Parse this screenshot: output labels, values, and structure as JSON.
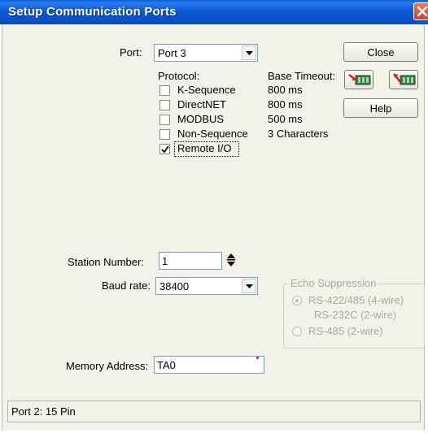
{
  "window": {
    "title": "Setup Communication Ports",
    "colors": {
      "titlebar": "#0a5fd8",
      "close_button": "#d55a3c",
      "background": "#f2f1ea"
    }
  },
  "port": {
    "label": "Port:",
    "selected": "Port 3"
  },
  "buttons": {
    "close": "Close",
    "help": "Help",
    "upload_icon": "plc-to-pc-icon",
    "download_icon": "pc-to-plc-icon"
  },
  "protocol": {
    "header": "Protocol:",
    "timeout_header": "Base Timeout:",
    "items": [
      {
        "label": "K-Sequence",
        "timeout": "800 ms",
        "checked": false
      },
      {
        "label": "DirectNET",
        "timeout": "800 ms",
        "checked": false
      },
      {
        "label": "MODBUS",
        "timeout": "500 ms",
        "checked": false
      },
      {
        "label": "Non-Sequence",
        "timeout": "3 Characters",
        "checked": false
      },
      {
        "label": "Remote I/O",
        "timeout": "",
        "checked": true
      }
    ]
  },
  "station": {
    "label": "Station Number:",
    "value": "1"
  },
  "baud": {
    "label": "Baud rate:",
    "selected": "38400"
  },
  "echo": {
    "title": "Echo Suppression",
    "options": [
      {
        "label": "RS-422/485 (4-wire)",
        "selected": true
      },
      {
        "label": "RS-232C (2-wire)",
        "selected": false
      },
      {
        "label": "RS-485 (2-wire)",
        "selected": false
      }
    ]
  },
  "memory": {
    "label": "Memory Address:",
    "value": "TA0"
  },
  "status": {
    "text": "Port 2: 15 Pin"
  }
}
